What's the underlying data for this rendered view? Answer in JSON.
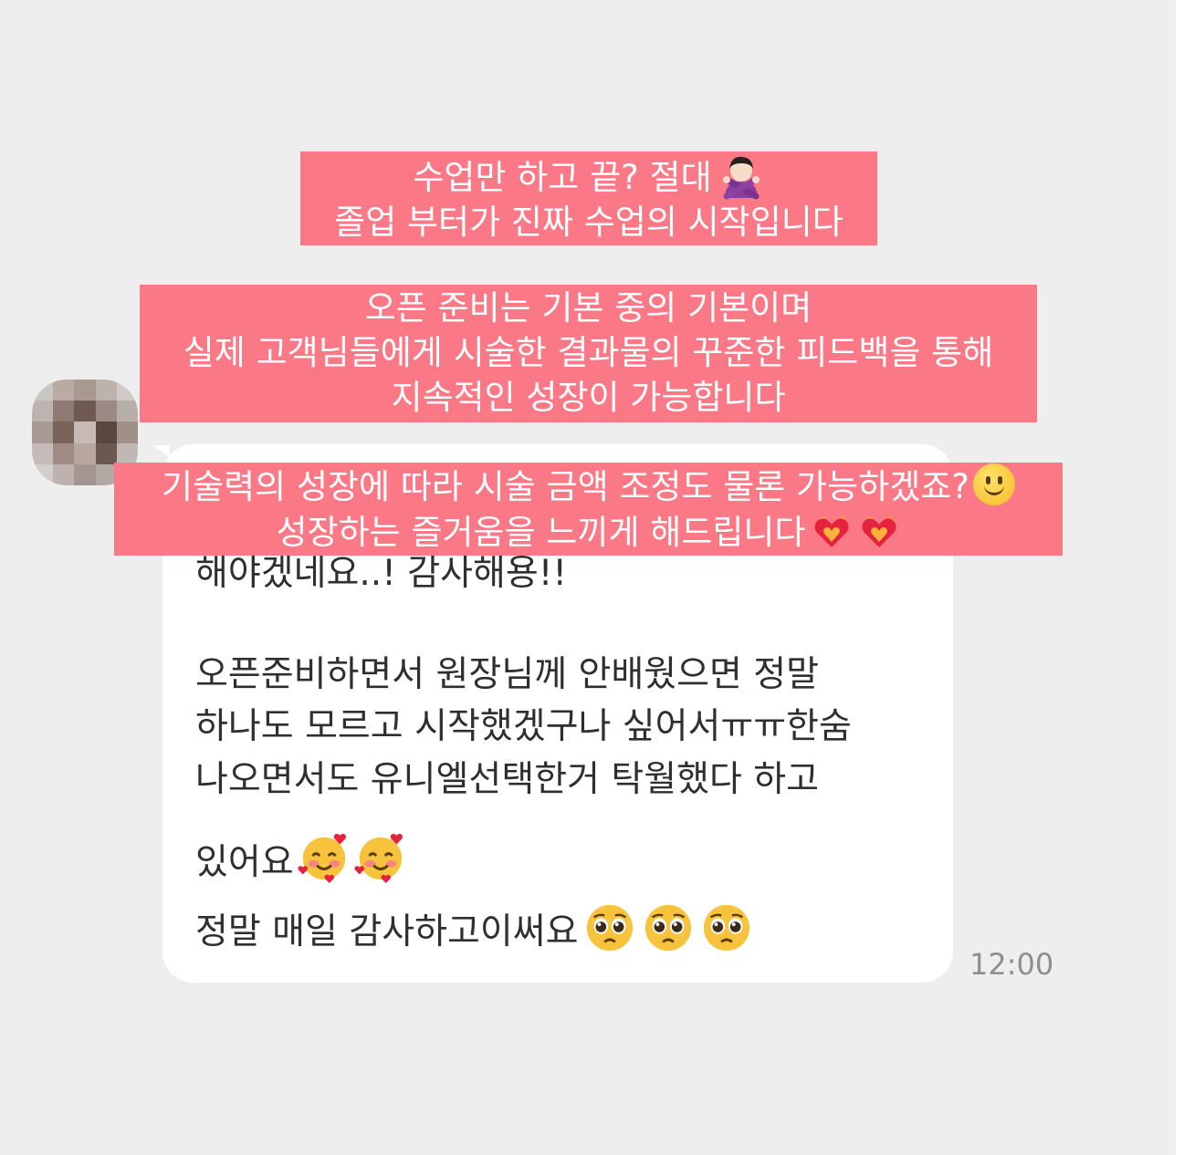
{
  "chat": {
    "message_lines": [
      "해야겠네요..! 감사해용!!",
      "오픈준비하면서 원장님께 안배웠으면 정말",
      "하나도 모르고 시작했겠구나 싶어서ㅠㅠ한숨",
      "나오면서도 유니엘선택한거 탁월했다 하고",
      "있어요",
      "정말 매일 감사하고이써요"
    ],
    "timestamp": "12:00"
  },
  "overlays": {
    "box1": [
      "수업만 하고 끝? 절대",
      "졸업 부터가 진짜 수업의 시작입니다"
    ],
    "box2": [
      "오픈 준비는 기본 중의 기본이며",
      "실제 고객님들에게 시술한 결과물의 꾸준한 피드백을 통해",
      "지속적인 성장이 가능합니다"
    ],
    "box3": [
      "기술력의 성장에 따라 시술 금액 조정도 물론 가능하겠죠?",
      "성장하는 즐거움을 느끼게 해드립니다"
    ]
  },
  "icons": {
    "avatar": "blurred-avatar",
    "emoji_crossed_arms": "person-gesturing-no-icon",
    "emoji_smile": "slightly-smiling-face-icon",
    "emoji_heart_fire": "heart-on-fire-icon",
    "emoji_love": "smiling-face-with-hearts-icon",
    "emoji_plead": "pleading-face-icon"
  },
  "colors": {
    "background": "#eeeeee",
    "bubble": "#ffffff",
    "overlay": "#fb7987",
    "overlay_text": "#ffffff",
    "timestamp": "#8e8e8e"
  }
}
